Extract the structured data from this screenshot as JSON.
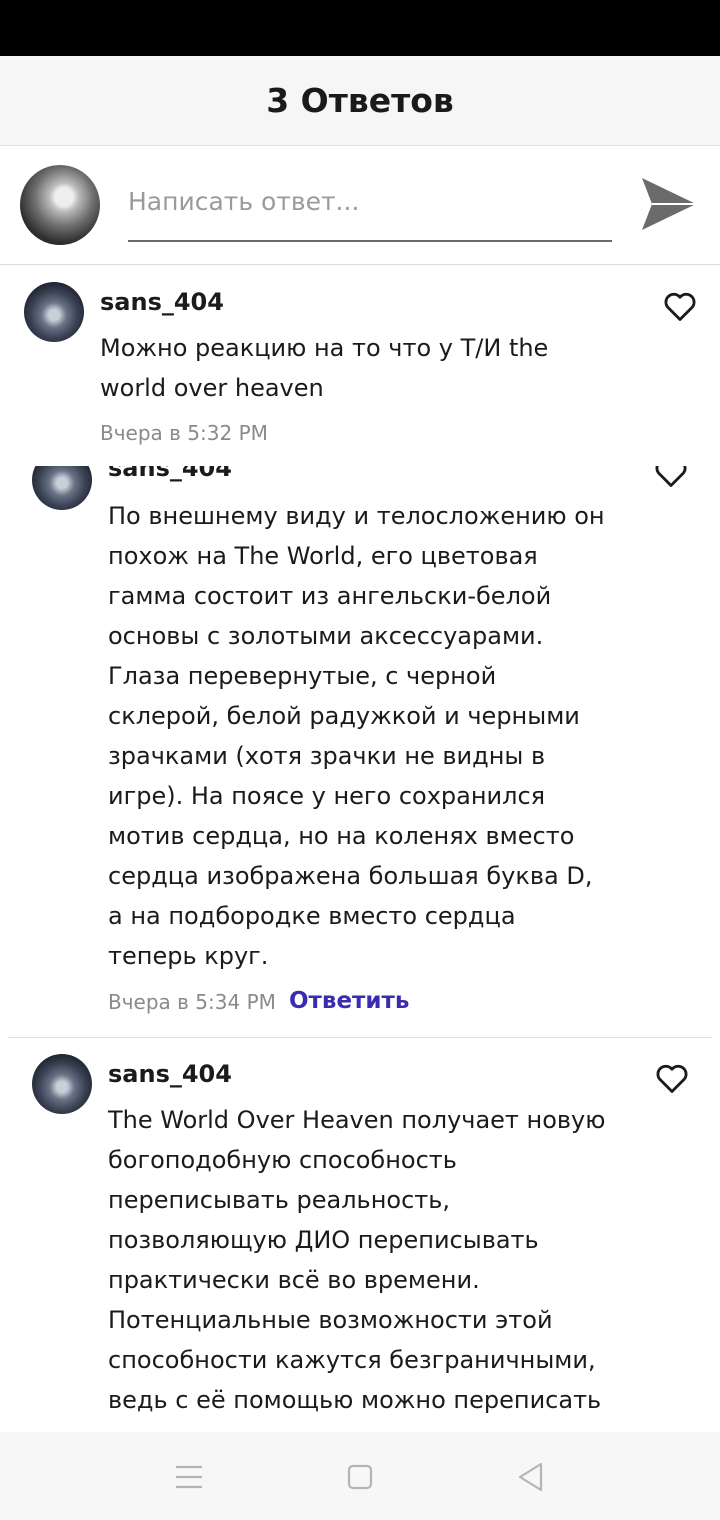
{
  "header": {
    "title": "3 Ответов"
  },
  "reply_bar": {
    "placeholder": "Написать ответ..."
  },
  "comments": [
    {
      "username": "sans_404",
      "text": "Можно реакцию на то что у Т/И the world over heaven",
      "time": "Вчера в 5:32 PM"
    },
    {
      "username": "sans_404",
      "text": "По внешнему виду и телосложению он похож на The World, его цветовая гамма состоит из ангельски-белой основы с золотыми аксессуарами. Глаза перевернутые, с черной склерой, белой радужкой и черными зрачками (хотя зрачки не видны в игре). На поясе у него сохранился мотив сердца, но на коленях вместо сердца изображена большая буква D, а на подбородке вместо сердца теперь круг.",
      "time": "Вчера в 5:34 PM",
      "reply_label": "Ответить"
    },
    {
      "username": "sans_404",
      "text": "The World Over Heaven получает новую богоподобную способность переписывать реальность, позволяющую ДИО переписывать практически всё во времени. Потенциальные возможности этой способности кажутся безграничными, ведь с её помощью можно переписать"
    }
  ],
  "icons": {
    "send": "send-icon",
    "like": "heart-icon",
    "nav": [
      "menu-icon",
      "home-icon",
      "back-icon"
    ]
  },
  "colors": {
    "accent": "#3b2bb3",
    "status_bar": "#000000",
    "header_bg": "#f6f6f6",
    "muted_text": "#8a8a8a"
  }
}
